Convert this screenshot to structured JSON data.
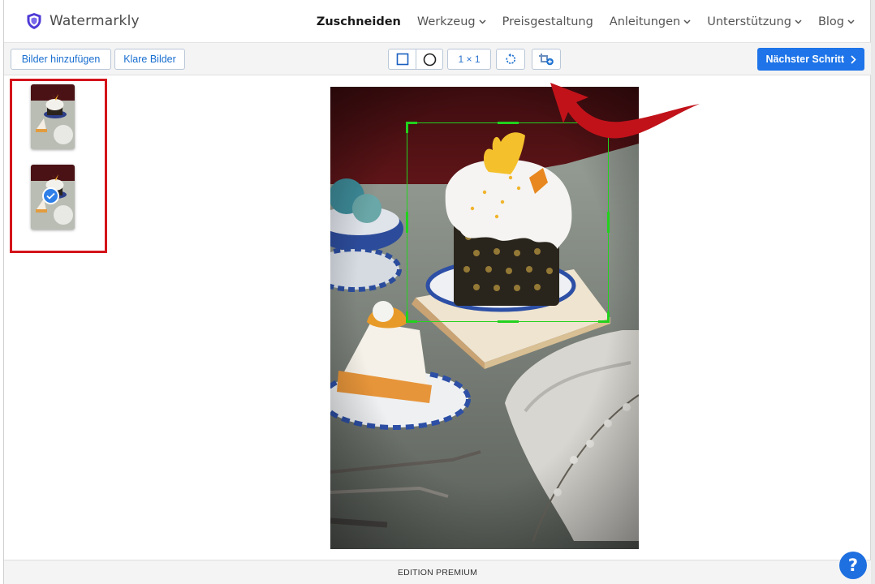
{
  "app": {
    "brand": "Watermarkly",
    "accent": "#1e74e8",
    "highlight": "#d4131b",
    "crop_color": "#22d11e"
  },
  "nav": [
    {
      "label": "Zuschneiden",
      "active": true,
      "dropdown": false
    },
    {
      "label": "Werkzeug",
      "active": false,
      "dropdown": true
    },
    {
      "label": "Preisgestaltung",
      "active": false,
      "dropdown": false
    },
    {
      "label": "Anleitungen",
      "active": false,
      "dropdown": true
    },
    {
      "label": "Unterstützung",
      "active": false,
      "dropdown": true
    },
    {
      "label": "Blog",
      "active": false,
      "dropdown": true
    }
  ],
  "toolbar": {
    "add_images": "Bilder hinzufügen",
    "clear_images": "Klare Bilder",
    "ratio": "1 × 1",
    "next_step": "Nächster Schritt",
    "tools": [
      "square-icon",
      "circle-icon",
      "rotate-icon",
      "add-crop-icon"
    ]
  },
  "thumbnails": [
    {
      "name": "thumbnail-1",
      "selected": false
    },
    {
      "name": "thumbnail-2",
      "selected": true
    }
  ],
  "footer": {
    "edition": "EDITION PREMIUM",
    "help": "?"
  }
}
